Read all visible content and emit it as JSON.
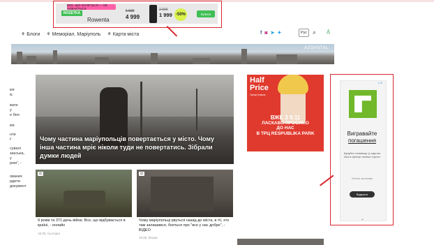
{
  "top_ad": {
    "badge": "ROZETKA",
    "promo": "ВСЕ, ЩО ХОЧЕТЬСЯ — НЕ ХОВАЄТЬСЯ",
    "brand": "Rowenta",
    "old_price_1": "5 589",
    "price_1": "4 999",
    "old_price_2": "2 999",
    "price_2": "1 999",
    "discount": "-50%",
    "buy_label": "Купити"
  },
  "nav": {
    "items": [
      {
        "icon": "sprout-icon",
        "label": "Блоги"
      },
      {
        "icon": "sprout-icon",
        "label": "Меморіал. Маріуполь"
      },
      {
        "icon": "sprout-icon",
        "label": "Карта міста"
      }
    ],
    "social": [
      {
        "icon": "facebook-icon",
        "glyph": "f",
        "color": "#3b5998"
      },
      {
        "icon": "instagram-icon",
        "glyph": "◙",
        "color": "#c13584"
      },
      {
        "icon": "telegram-icon",
        "glyph": "➤",
        "color": "#2a9fd8"
      },
      {
        "icon": "twitter-icon",
        "glyph": "🐦",
        "color": "#1da1f2"
      }
    ],
    "lang": "Рус"
  },
  "banner": {
    "label": "AZOVSTAL"
  },
  "left_column": [
    "кія",
    "іє",
    "вати",
    "у",
    "е бея",
    "кія",
    "нти",
    "ґ",
    "сувалі",
    "заєська,",
    "у",
    "ром\", -",
    "",
    "ованих",
    "рдити",
    "документ"
  ],
  "main_article": {
    "title": "Чому частина маріупольців повертається у місто. Чому інша частина мріє ніколи туди не повертатись. Зібрали думки людей"
  },
  "small_articles": [
    {
      "caption": "9 років та 371 день війни. Все, що відбувається в країні, - онлайн",
      "date": "18.05, Сьогодні"
    },
    {
      "caption": "Чому маріупольці рвуться назад до міста, в тії, хто там залишився, бояться про \"все у нас добре\", - ВІДЕО",
      "date": "18.05, Вчора"
    }
  ],
  "half_price_ad": {
    "title_line1": "Half",
    "title_line2": "Price",
    "subtitle": "Гренд Знижок",
    "line1": "ВЖЕ З 9.11",
    "line2": "ЛАСКАВО ПРОСИМО",
    "line3": "ДО НАС",
    "line4": "В ТРЦ RESPUBLIKA PARK"
  },
  "right_ad": {
    "heading_line1": "Вигравайте",
    "heading_line2": "погашення",
    "body": "Купуйте телевізор (з картою Viza в Центрі техніки «Цеге»",
    "fine": "Оплата частинами",
    "button": "Відкрити"
  }
}
